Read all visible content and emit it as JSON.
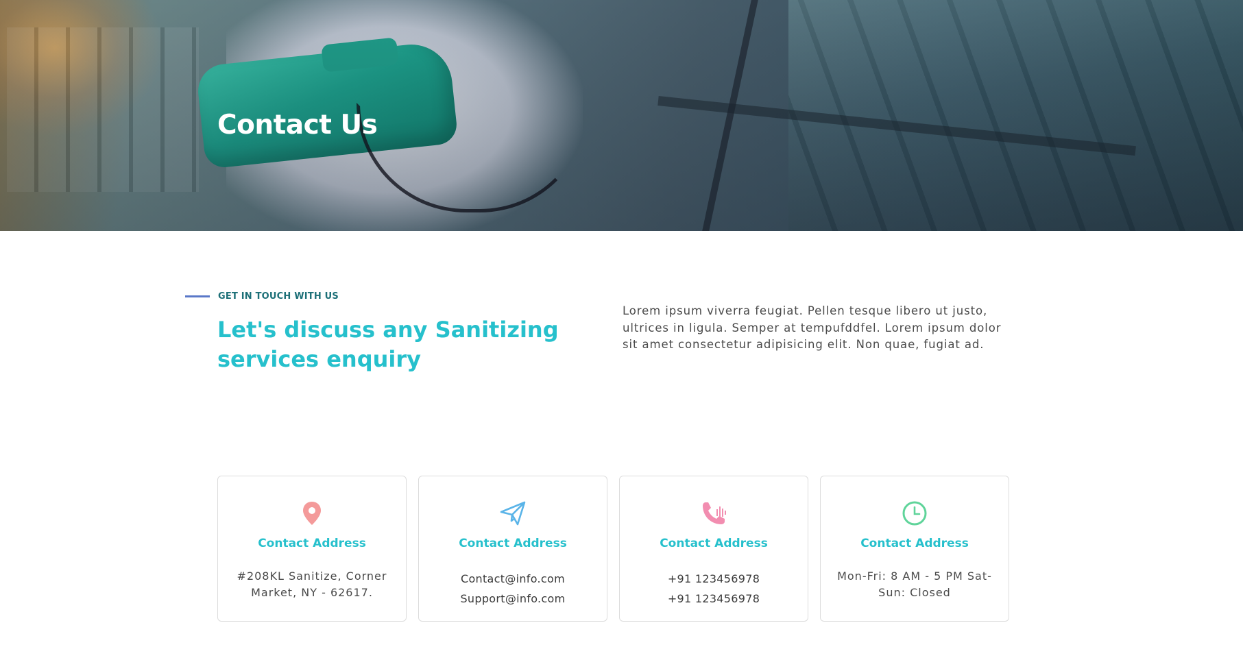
{
  "hero": {
    "title": "Contact Us"
  },
  "intro": {
    "eyebrow": "GET IN TOUCH WITH US",
    "headline": "Let's discuss any Sanitizing services enquiry",
    "text": "Lorem ipsum viverra feugiat. Pellen tesque libero ut justo, ultrices in ligula. Semper at tempufddfel. Lorem ipsum dolor sit amet consectetur adipisicing elit. Non quae, fugiat ad."
  },
  "cards": [
    {
      "icon": "location-pin-icon",
      "icon_color": "#f28b8b",
      "title": "Contact Address",
      "lines": [
        "#208KL Sanitize, Corner Market, NY - 62617."
      ]
    },
    {
      "icon": "paper-plane-icon",
      "icon_color": "#5ab4e8",
      "title": "Contact Address",
      "lines": [
        "Contact@info.com",
        "Support@info.com"
      ]
    },
    {
      "icon": "phone-call-icon",
      "icon_color": "#f07fa6",
      "title": "Contact Address",
      "lines": [
        "+91 123456978",
        "+91 123456978"
      ]
    },
    {
      "icon": "clock-icon",
      "icon_color": "#5fd49a",
      "title": "Contact Address",
      "lines": [
        "Mon-Fri: 8 AM - 5 PM Sat-Sun: Closed"
      ]
    }
  ],
  "colors": {
    "accent": "#26c0cc",
    "eyebrow": "#1c6f77",
    "eyebrow_line": "#5a78c8"
  }
}
